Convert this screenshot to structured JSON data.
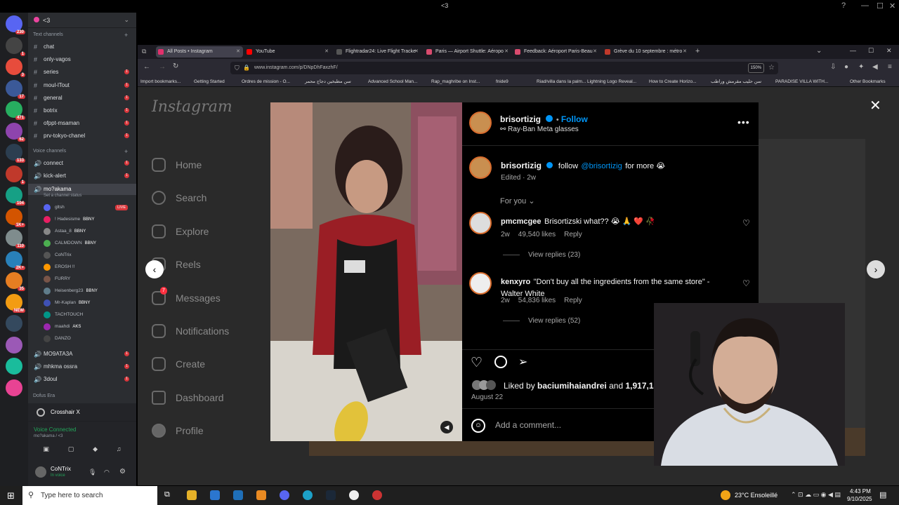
{
  "window": {
    "title": "<3"
  },
  "discord": {
    "server_name": "<3",
    "server_badges": [
      "230",
      "1",
      "3",
      "17",
      "471",
      "62",
      "133",
      "1",
      "104",
      "1K+",
      "110",
      "2K+",
      "35",
      "NEW"
    ],
    "text_category": "Text channels",
    "text_channels": [
      {
        "name": "chat",
        "unread": false
      },
      {
        "name": "only-vagos",
        "unread": false
      },
      {
        "name": "series",
        "unread": true
      },
      {
        "name": "moul-lTout",
        "unread": true
      },
      {
        "name": "general",
        "unread": true
      },
      {
        "name": "botrix",
        "unread": true
      },
      {
        "name": "ofppt-msaman",
        "unread": true
      },
      {
        "name": "prv-tokyo-chanel",
        "unread": true
      }
    ],
    "voice_category": "Voice channels",
    "voice_channels": [
      {
        "name": "connect",
        "unread": true
      },
      {
        "name": "kick-alert",
        "unread": true
      }
    ],
    "active_voice": {
      "name": "mo?akama",
      "status": "Set a channel status"
    },
    "voice_users": [
      {
        "name": "gltsh",
        "tag": "LIVE"
      },
      {
        "name": "! Hadesisme",
        "tag": "BBNY"
      },
      {
        "name": "Astaa_8",
        "tag": "BBNY"
      },
      {
        "name": "CALMDOWN",
        "tag": "BBNY"
      },
      {
        "name": "CoNTrix",
        "tag": ""
      },
      {
        "name": "EROSH !!",
        "tag": ""
      },
      {
        "name": "FURRY",
        "tag": ""
      },
      {
        "name": "Heisenberg23",
        "tag": "BBNY"
      },
      {
        "name": "Mr-Kaplan",
        "tag": "BBNY"
      },
      {
        "name": "TACHTOUCH",
        "tag": ""
      },
      {
        "name": "maahdi",
        "tag": "AKS"
      },
      {
        "name": "DANZO",
        "tag": ""
      }
    ],
    "more_channels": [
      {
        "name": "MO9ATA3A",
        "unread": true
      },
      {
        "name": "mhkma ossra",
        "unread": true
      },
      {
        "name": "3doul",
        "unread": true
      }
    ],
    "bottom_category": "Dofus Era",
    "crosshair": "Crosshair X",
    "voice_connected": "Voice Connected",
    "voice_connected_sub": "mo?akama / <3",
    "user_name": "CoNTrix",
    "user_status": "In voice"
  },
  "browser": {
    "tabs": [
      {
        "title": "All Posts • Instagram",
        "color": "#e1306c",
        "active": true
      },
      {
        "title": "YouTube",
        "color": "#ff0000",
        "active": false
      },
      {
        "title": "Flightradar24: Live Flight Tracke",
        "color": "#555555",
        "active": false
      },
      {
        "title": "Paris — Airport Shuttle: Aéropo",
        "color": "#d94b6e",
        "active": false
      },
      {
        "title": "Feedback: Aéroport Paris-Beau",
        "color": "#d94b6e",
        "active": false
      },
      {
        "title": "Grève du 10 septembre : métro",
        "color": "#c0392b",
        "active": false
      }
    ],
    "url": "www.instagram.com/p/DNpDhFaxzhF/",
    "zoom": "150%",
    "bookmarks": [
      "Import bookmarks...",
      "Getting Started",
      "Ordres de mission - O...",
      "سن مطبخين دجاج محمر",
      "Advanced School Man...",
      "Rap_maghribe on Inst...",
      "fnide9",
      "Riad/villa dans la palm...",
      "Lightning Logo Reveal...",
      "How to Create Horizo...",
      "سن حليب مقرمش وراطب",
      "PARADISE VILLA WITH..."
    ],
    "other_bookmarks": "Other Bookmarks"
  },
  "instagram": {
    "logo": "Instagram",
    "nav": [
      "Home",
      "Search",
      "Explore",
      "Reels",
      "Messages",
      "Notifications",
      "Create",
      "Dashboard",
      "Profile"
    ],
    "messages_badge": "7",
    "post": {
      "author": "brisortizig",
      "follow": "Follow",
      "subtitle": "Ray-Ban Meta glasses",
      "caption_mention": "@brisortizig",
      "caption_pre": "follow",
      "caption_post": "for more 😭",
      "edited": "Edited · 2w",
      "for_you": "For you",
      "comments": [
        {
          "user": "pmcmcgee",
          "text": "Brisortizski what?? 😭 🙏 ❤️ 🥀",
          "age": "2w",
          "likes": "49,540 likes",
          "reply": "Reply",
          "view": "View replies (23)"
        },
        {
          "user": "kenxyro",
          "text": "\"Don't buy all the ingredients from the same store\" - Walter White",
          "age": "2w",
          "likes": "54,836 likes",
          "reply": "Reply",
          "view": "View replies (52)"
        }
      ],
      "liked_by_user": "baciumihaiandrei",
      "liked_by_rest": "1,917,186 others",
      "liked_prefix": "Liked by",
      "liked_and": "and",
      "date": "August 22",
      "add_comment": "Add a comment..."
    }
  },
  "taskbar": {
    "search_placeholder": "Type here to search",
    "weather": "23°C  Ensoleillé",
    "time": "4:43 PM",
    "date": "9/10/2025"
  }
}
